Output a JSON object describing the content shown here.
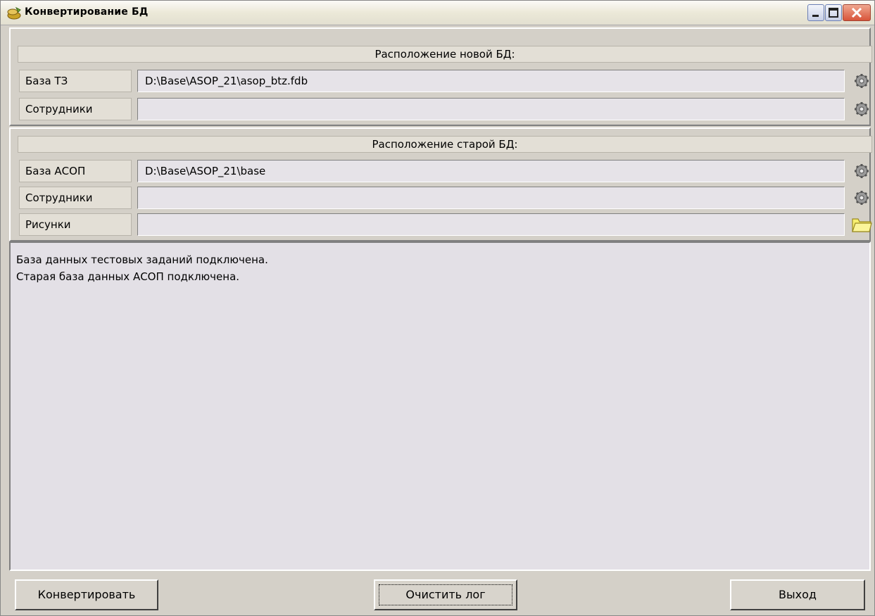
{
  "window": {
    "title": "Конвертирование БД"
  },
  "new_db": {
    "header": "Расположение новой БД:",
    "rows": [
      {
        "label": "База ТЗ",
        "value": "D:\\Base\\ASOP_21\\asop_btz.fdb",
        "button_icon": "gear-icon"
      },
      {
        "label": "Сотрудники",
        "value": "",
        "button_icon": "gear-icon"
      }
    ]
  },
  "old_db": {
    "header": "Расположение старой БД:",
    "rows": [
      {
        "label": "База АСОП",
        "value": "D:\\Base\\ASOP_21\\base",
        "button_icon": "gear-icon"
      },
      {
        "label": "Сотрудники",
        "value": "",
        "button_icon": "gear-icon"
      },
      {
        "label": "Рисунки",
        "value": "",
        "button_icon": "folder-icon"
      }
    ]
  },
  "log": {
    "lines": [
      "База данных тестовых заданий подключена.",
      "Старая база данных АСОП подключена."
    ]
  },
  "buttons": {
    "convert": "Конвертировать",
    "clear_log": "Очистить лог",
    "exit": "Выход"
  },
  "colors": {
    "panel": "#d4d0c8",
    "field": "#e6e3e8",
    "folder": "#f8f070"
  }
}
